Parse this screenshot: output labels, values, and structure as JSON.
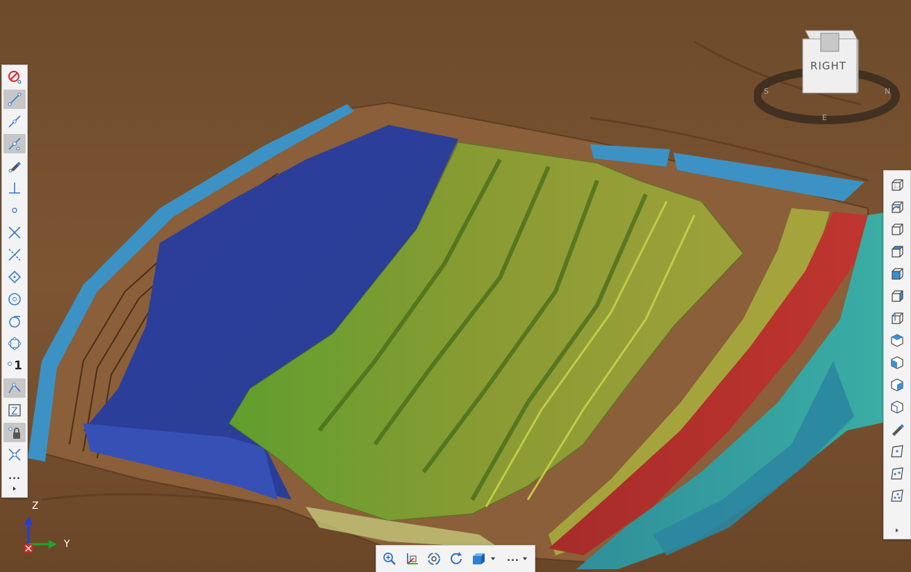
{
  "viewport": {
    "colors": {
      "terrain": "#7a5532",
      "terrain_light": "#a97a4c",
      "pit_floor_blue": "#2e44a6",
      "water_blue": "#3a8fc0",
      "bench_green": "#5c9a2a",
      "bench_yellow": "#a9a83a",
      "bench_red": "#b5312e",
      "bench_cyan": "#3aa8a8"
    }
  },
  "nav_cube": {
    "face_label": "RIGHT",
    "compass": [
      "S",
      "E",
      "N"
    ]
  },
  "axis_triad": {
    "z_label": "Z",
    "y_label": "Y"
  },
  "snap_toolbar": {
    "items": [
      {
        "icon": "no-snap-icon"
      },
      {
        "icon": "snap-line-icon",
        "active": true
      },
      {
        "icon": "snap-midpoint-icon"
      },
      {
        "icon": "snap-nearest-icon",
        "active": true
      },
      {
        "icon": "snap-point-pick-icon"
      },
      {
        "icon": "snap-perpendicular-icon"
      },
      {
        "icon": "snap-point-icon"
      },
      {
        "icon": "snap-intersection-icon"
      },
      {
        "icon": "snap-apparent-intersection-icon"
      },
      {
        "icon": "snap-quadrant-icon"
      },
      {
        "icon": "snap-center-icon"
      },
      {
        "icon": "snap-tangent-icon"
      },
      {
        "icon": "snap-circle-points-icon"
      },
      {
        "icon": "snap-single-icon",
        "label": "1"
      },
      {
        "icon": "snap-vertex-icon",
        "active": true
      },
      {
        "icon": "snap-z-icon",
        "label": "Z"
      },
      {
        "icon": "snap-lock-icon",
        "active": true
      },
      {
        "icon": "snap-extension-icon"
      },
      {
        "icon": "more-icon",
        "label": "..."
      },
      {
        "icon": "expand-arrow-icon"
      }
    ]
  },
  "view_toolbar": {
    "items": [
      {
        "icon": "wireframe-cube-icon"
      },
      {
        "icon": "rotate-cube-icon"
      },
      {
        "icon": "cube-view-front-icon"
      },
      {
        "icon": "cube-view-top-icon"
      },
      {
        "icon": "cube-view-left-icon"
      },
      {
        "icon": "cube-view-right-icon"
      },
      {
        "icon": "cube-view-back-icon"
      },
      {
        "icon": "cube-iso-1-icon"
      },
      {
        "icon": "cube-iso-2-icon"
      },
      {
        "icon": "cube-iso-3-icon"
      },
      {
        "icon": "cube-iso-4-icon"
      },
      {
        "icon": "pen-icon"
      },
      {
        "icon": "point-frame-1-icon"
      },
      {
        "icon": "point-frame-2-icon"
      },
      {
        "icon": "point-frame-3-icon"
      },
      {
        "icon": "expand-arrow-icon"
      }
    ]
  },
  "bottom_toolbar": {
    "items": [
      {
        "icon": "zoom-icon"
      },
      {
        "icon": "axes-zoom-icon"
      },
      {
        "icon": "orbit-icon"
      },
      {
        "icon": "refresh-rotate-icon"
      },
      {
        "icon": "shaded-cube-icon"
      },
      {
        "icon": "dropdown-arrow-icon"
      },
      {
        "icon": "more-icon",
        "label": "..."
      },
      {
        "icon": "dropdown-arrow-icon"
      }
    ]
  }
}
